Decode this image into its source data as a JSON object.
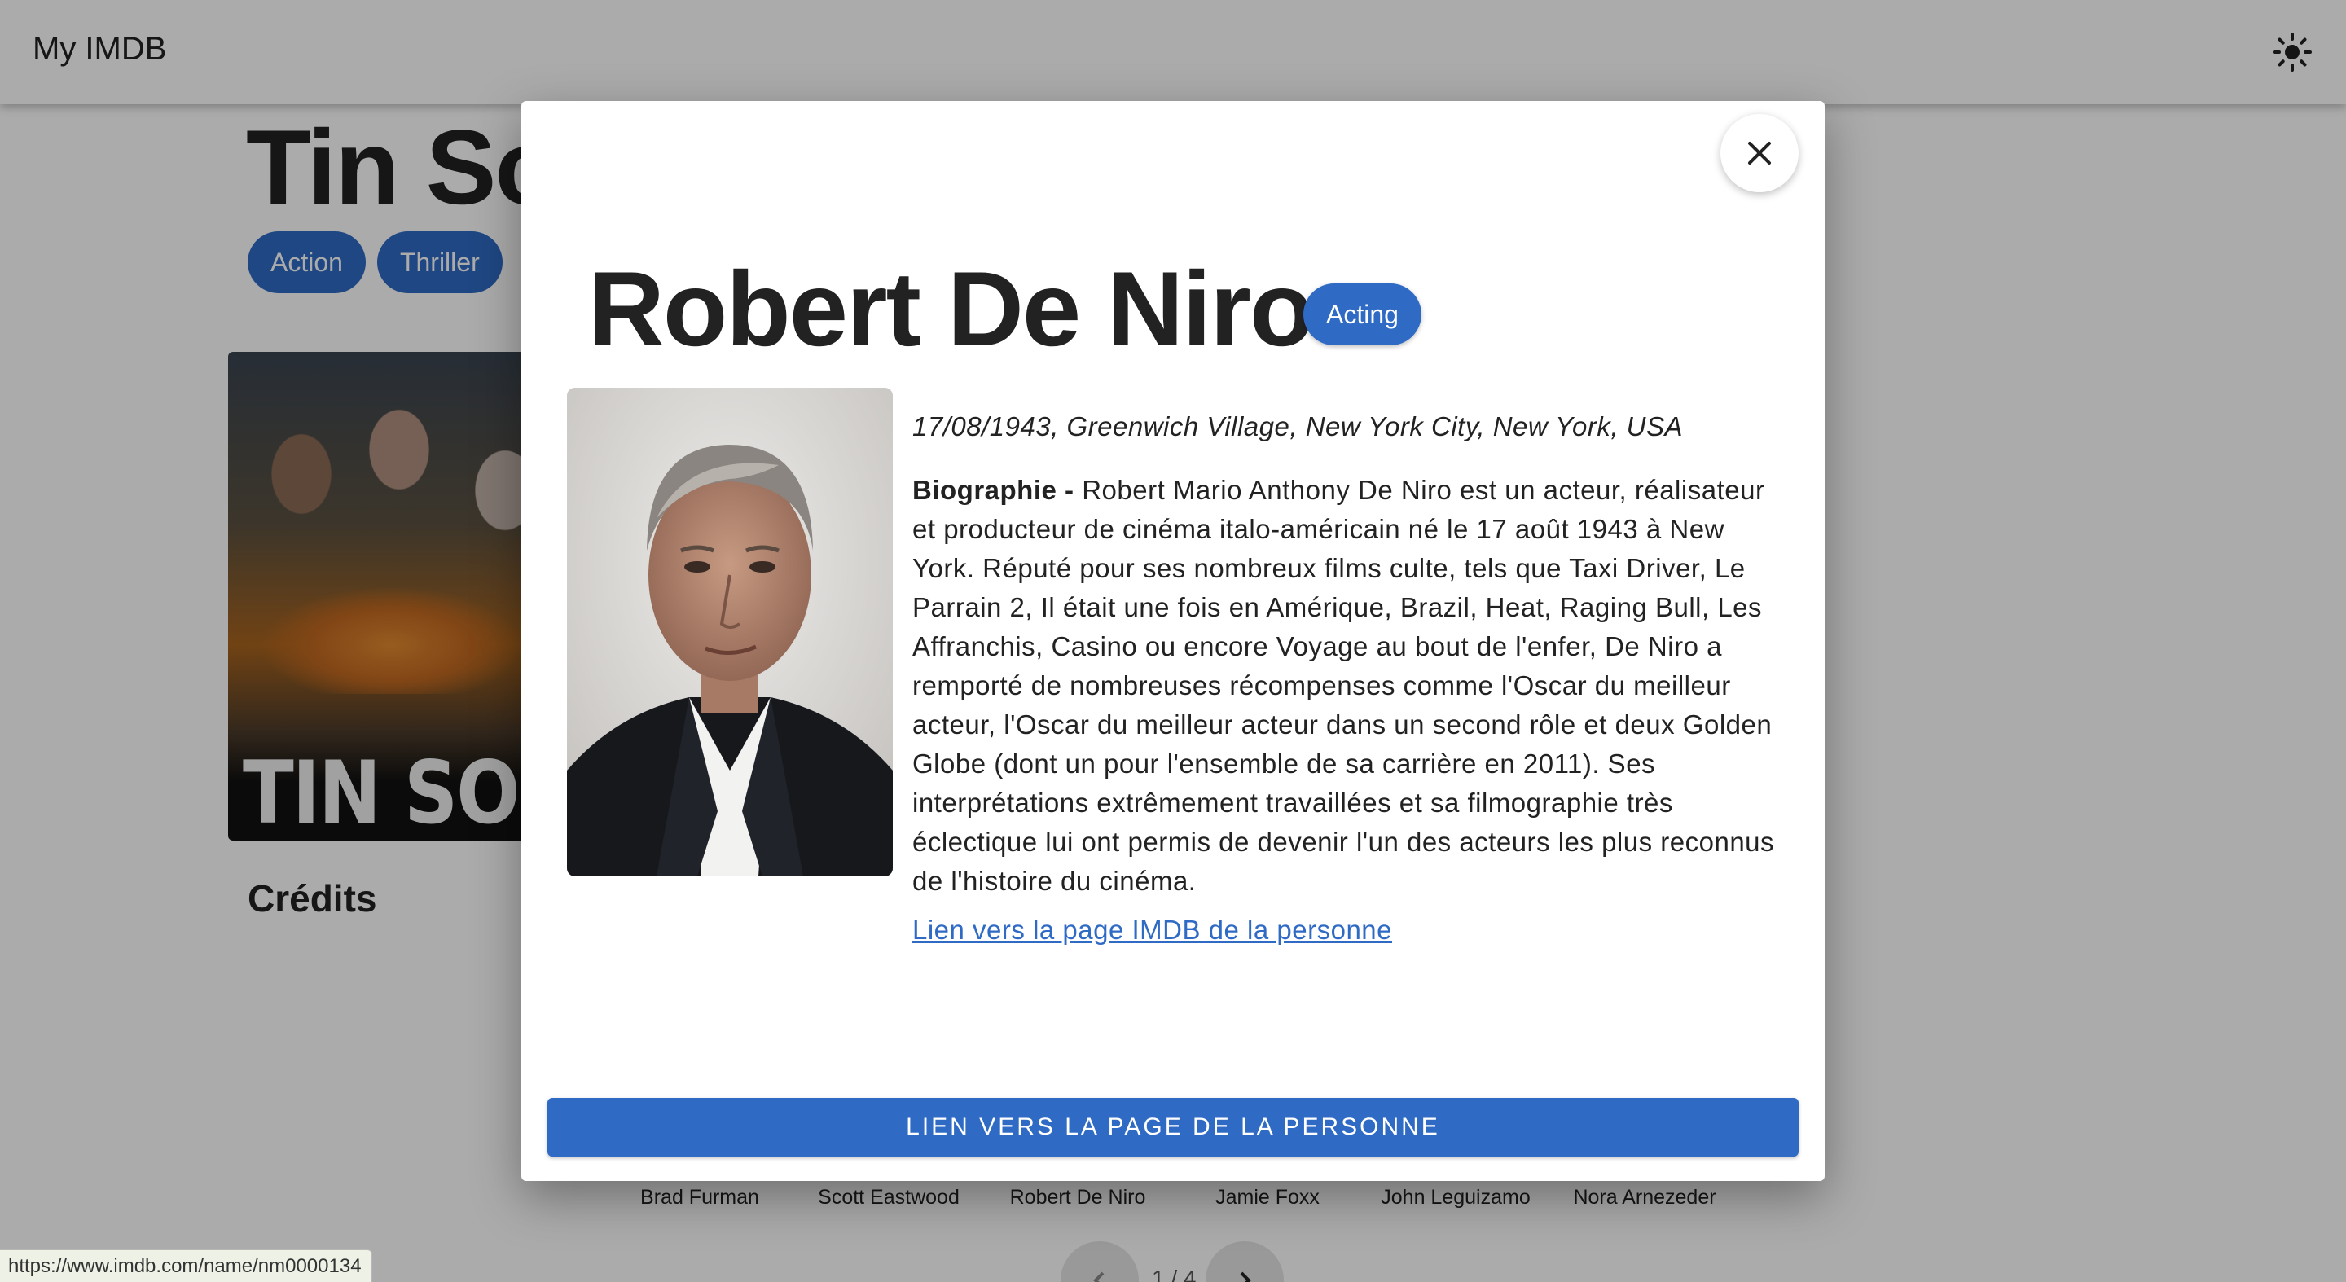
{
  "app": {
    "title": "My IMDB"
  },
  "movie": {
    "title": "Tin Soldier",
    "genres": [
      "Action",
      "Thriller"
    ],
    "poster_text": "TIN SOLDIER",
    "credits_heading": "Crédits",
    "cast": [
      "Brad Furman",
      "Scott Eastwood",
      "Robert De Niro",
      "Jamie Foxx",
      "John Leguizamo",
      "Nora Arnezeder"
    ],
    "pager": "1 / 4"
  },
  "modal": {
    "name": "Robert De Niro",
    "department": "Acting",
    "birth": "17/08/1943, Greenwich Village, New York City, New York, USA",
    "bio_label": "Biographie -",
    "bio": "Robert Mario Anthony De Niro est un acteur, réalisateur et producteur de cinéma italo-américain né le 17 août 1943 à New York. Réputé pour ses nombreux films culte, tels que Taxi Driver, Le Parrain 2, Il était une fois en Amérique, Brazil, Heat, Raging Bull, Les Affranchis, Casino ou encore Voyage au bout de l'enfer, De Niro a remporté de nombreuses récompenses comme l'Oscar du meilleur acteur, l'Oscar du meilleur acteur dans un second rôle et deux Golden Globe (dont un pour l'ensemble de sa carrière en 2011). Ses interprétations extrêmement travaillées et sa filmographie très éclectique lui ont permis de devenir l'un des acteurs les plus reconnus de l'histoire du cinéma.",
    "imdb_link": "Lien vers la page IMDB de la personne",
    "person_button": "LIEN VERS LA PAGE DE LA PERSONNE"
  },
  "status_bar": {
    "url": "https://www.imdb.com/name/nm0000134"
  },
  "colors": {
    "accent": "#2f6ac4",
    "backdrop": "rgba(0,0,0,0.33)"
  },
  "icons": {
    "theme": "sun-icon",
    "close": "close-icon",
    "prev": "chevron-left-icon",
    "next": "chevron-right-icon"
  }
}
